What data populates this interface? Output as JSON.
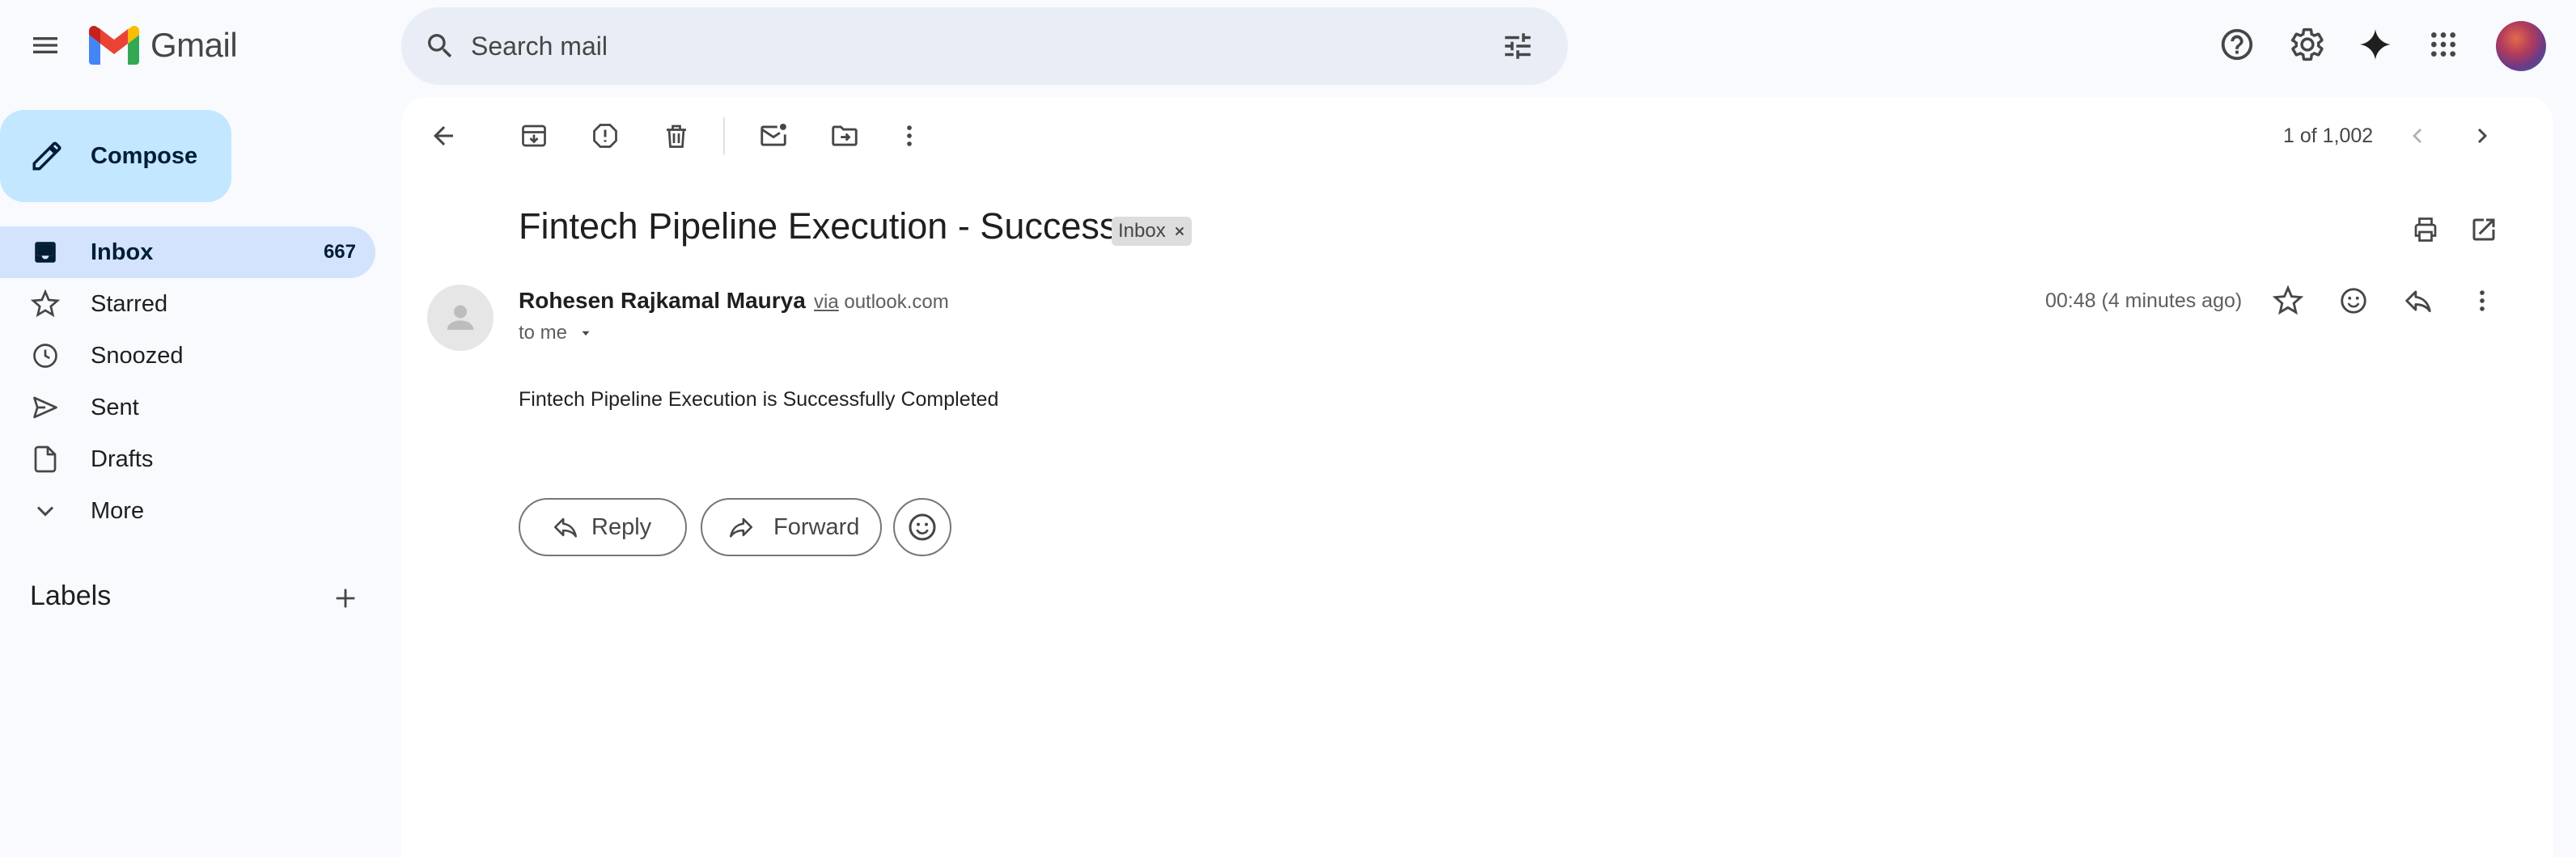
{
  "app": {
    "name": "Gmail"
  },
  "search": {
    "placeholder": "Search mail"
  },
  "compose": {
    "label": "Compose"
  },
  "sidebar": {
    "items": [
      {
        "label": "Inbox",
        "count": "667",
        "icon": "inbox-icon",
        "active": true
      },
      {
        "label": "Starred",
        "icon": "star-icon"
      },
      {
        "label": "Snoozed",
        "icon": "clock-icon"
      },
      {
        "label": "Sent",
        "icon": "send-icon"
      },
      {
        "label": "Drafts",
        "icon": "file-icon"
      },
      {
        "label": "More",
        "icon": "chevron-down-icon"
      }
    ],
    "labels_title": "Labels"
  },
  "toolbar": {
    "pager": "1 of 1,002"
  },
  "email": {
    "subject": "Fintech Pipeline Execution - Success",
    "label_chip": "Inbox",
    "sender_name": "Rohesen Rajkamal Maurya",
    "via_word": "via",
    "via_domain": "outlook.com",
    "recipient": "to me",
    "timestamp": "00:48 (4 minutes ago)",
    "body": "Fintech Pipeline Execution is Successfully Completed"
  },
  "actions": {
    "reply": "Reply",
    "forward": "Forward"
  },
  "colors": {
    "background": "#f8fafd",
    "search_bg": "#e9eef6",
    "compose_bg": "#c2e7ff",
    "active_nav_bg": "#d3e3fd",
    "panel_bg": "#ffffff"
  }
}
